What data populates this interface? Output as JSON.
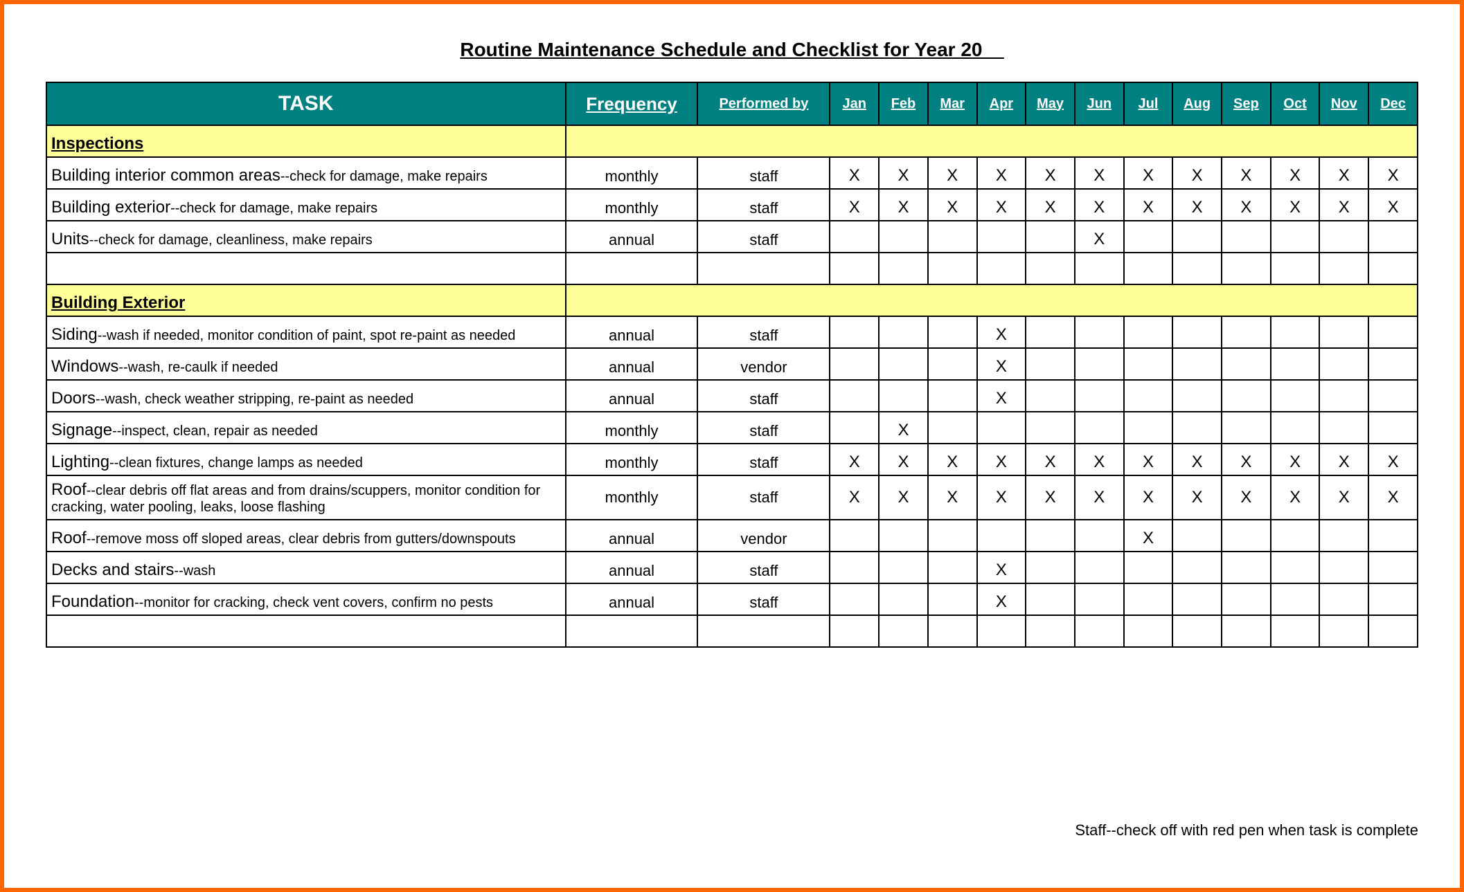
{
  "title": "Routine Maintenance Schedule and Checklist for Year 20__",
  "headers": {
    "task": "TASK",
    "frequency": "Frequency",
    "performed_by": "Performed by",
    "months": [
      "Jan",
      "Feb",
      "Mar",
      "Apr",
      "May",
      "Jun",
      "Jul",
      "Aug",
      "Sep",
      "Oct",
      "Nov",
      "Dec"
    ]
  },
  "sections": [
    {
      "name": "Inspections",
      "rows": [
        {
          "task_main": "Building interior common areas",
          "task_detail": "--check for damage, make repairs",
          "frequency": "monthly",
          "performed_by": "staff",
          "months": [
            "X",
            "X",
            "X",
            "X",
            "X",
            "X",
            "X",
            "X",
            "X",
            "X",
            "X",
            "X"
          ]
        },
        {
          "task_main": "Building exterior",
          "task_detail": "--check for damage, make repairs",
          "frequency": "monthly",
          "performed_by": "staff",
          "months": [
            "X",
            "X",
            "X",
            "X",
            "X",
            "X",
            "X",
            "X",
            "X",
            "X",
            "X",
            "X"
          ]
        },
        {
          "task_main": "Units",
          "task_detail": "--check for damage, cleanliness, make repairs",
          "frequency": "annual",
          "performed_by": "staff",
          "months": [
            "",
            "",
            "",
            "",
            "",
            "X",
            "",
            "",
            "",
            "",
            "",
            ""
          ]
        },
        {
          "task_main": "",
          "task_detail": "",
          "frequency": "",
          "performed_by": "",
          "months": [
            "",
            "",
            "",
            "",
            "",
            "",
            "",
            "",
            "",
            "",
            "",
            ""
          ]
        }
      ]
    },
    {
      "name": "Building Exterior",
      "rows": [
        {
          "task_main": "Siding",
          "task_detail": "--wash if needed, monitor condition of paint, spot re-paint as needed",
          "frequency": "annual",
          "performed_by": "staff",
          "months": [
            "",
            "",
            "",
            "X",
            "",
            "",
            "",
            "",
            "",
            "",
            "",
            ""
          ]
        },
        {
          "task_main": "Windows",
          "task_detail": "--wash, re-caulk if needed",
          "frequency": "annual",
          "performed_by": "vendor",
          "months": [
            "",
            "",
            "",
            "X",
            "",
            "",
            "",
            "",
            "",
            "",
            "",
            ""
          ]
        },
        {
          "task_main": "Doors",
          "task_detail": "--wash, check weather stripping, re-paint as needed",
          "frequency": "annual",
          "performed_by": "staff",
          "months": [
            "",
            "",
            "",
            "X",
            "",
            "",
            "",
            "",
            "",
            "",
            "",
            ""
          ]
        },
        {
          "task_main": "Signage",
          "task_detail": "--inspect, clean, repair as needed",
          "frequency": "monthly",
          "performed_by": "staff",
          "months": [
            "",
            "X",
            "",
            "",
            "",
            "",
            "",
            "",
            "",
            "",
            "",
            ""
          ]
        },
        {
          "task_main": "Lighting",
          "task_detail": "--clean fixtures, change lamps as needed",
          "frequency": "monthly",
          "performed_by": "staff",
          "months": [
            "X",
            "X",
            "X",
            "X",
            "X",
            "X",
            "X",
            "X",
            "X",
            "X",
            "X",
            "X"
          ]
        },
        {
          "task_main": "Roof",
          "task_detail": "--clear debris off flat areas and from drains/scuppers, monitor condition for cracking, water pooling, leaks, loose flashing",
          "frequency": "monthly",
          "performed_by": "staff",
          "months": [
            "X",
            "X",
            "X",
            "X",
            "X",
            "X",
            "X",
            "X",
            "X",
            "X",
            "X",
            "X"
          ],
          "tall": true
        },
        {
          "task_main": "Roof",
          "task_detail": "--remove moss off sloped areas, clear debris from gutters/downspouts",
          "frequency": "annual",
          "performed_by": "vendor",
          "months": [
            "",
            "",
            "",
            "",
            "",
            "",
            "X",
            "",
            "",
            "",
            "",
            ""
          ]
        },
        {
          "task_main": "Decks and stairs",
          "task_detail": "--wash",
          "frequency": "annual",
          "performed_by": "staff",
          "months": [
            "",
            "",
            "",
            "X",
            "",
            "",
            "",
            "",
            "",
            "",
            "",
            ""
          ]
        },
        {
          "task_main": "Foundation",
          "task_detail": "--monitor for cracking, check vent covers, confirm no pests",
          "frequency": "annual",
          "performed_by": "staff",
          "months": [
            "",
            "",
            "",
            "X",
            "",
            "",
            "",
            "",
            "",
            "",
            "",
            ""
          ]
        },
        {
          "task_main": "",
          "task_detail": "",
          "frequency": "",
          "performed_by": "",
          "months": [
            "",
            "",
            "",
            "",
            "",
            "",
            "",
            "",
            "",
            "",
            "",
            ""
          ]
        }
      ]
    }
  ],
  "footer_note": "Staff--check off with red pen when task is complete"
}
